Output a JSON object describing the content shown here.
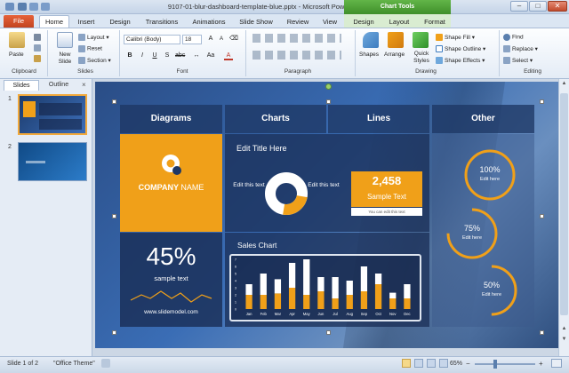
{
  "window": {
    "title": "9107-01-blur-dashboard-template-blue.pptx - Microsoft PowerPoint",
    "contextual_tab_group": "Chart Tools"
  },
  "tabs": [
    "File",
    "Home",
    "Insert",
    "Design",
    "Transitions",
    "Animations",
    "Slide Show",
    "Review",
    "View",
    "Design",
    "Layout",
    "Format"
  ],
  "ribbon": {
    "clipboard": {
      "paste": "Paste",
      "label": "Clipboard"
    },
    "slides": {
      "new_slide": "New Slide",
      "layout": "Layout",
      "reset": "Reset",
      "section": "Section",
      "label": "Slides"
    },
    "font": {
      "name": "Calibri (Body)",
      "size": "18",
      "label": "Font"
    },
    "paragraph": {
      "label": "Paragraph"
    },
    "drawing": {
      "shapes": "Shapes",
      "arrange": "Arrange",
      "quick_styles": "Quick Styles",
      "shape_fill": "Shape Fill",
      "shape_outline": "Shape Outline",
      "shape_effects": "Shape Effects",
      "label": "Drawing"
    },
    "editing": {
      "find": "Find",
      "replace": "Replace",
      "select": "Select",
      "label": "Editing"
    }
  },
  "left_pane": {
    "tab_slides": "Slides",
    "tab_outline": "Outline",
    "close": "×",
    "slide_numbers": [
      "1",
      "2"
    ]
  },
  "slide": {
    "headers": [
      "Diagrams",
      "Charts",
      "Lines",
      "Other"
    ],
    "company_name_1": "COMPANY",
    "company_name_2": "NAME",
    "big_percent": "45%",
    "sample_text": "sample text",
    "website": "www.slidemodel.com",
    "edit_title": "Edit Title Here",
    "edit_left": "Edit this text",
    "edit_right": "Edit this text",
    "big_number": "2,458",
    "sample_box_text": "Sample Text",
    "sample_box_sub": "You can edit this text",
    "sales_title": "Sales Chart",
    "donuts": [
      {
        "value": 100,
        "label": "100%",
        "sub": "Edit here"
      },
      {
        "value": 75,
        "label": "75%",
        "sub": "Edit here"
      },
      {
        "value": 50,
        "label": "50%",
        "sub": "Edit here"
      }
    ],
    "colors": {
      "accent": "#f0a019",
      "white": "#ffffff",
      "navy": "#1e3764"
    }
  },
  "chart_data": {
    "type": "bar",
    "categories": [
      "Jan",
      "Feb",
      "Mar",
      "Apr",
      "May",
      "Jun",
      "Jul",
      "Aug",
      "Sep",
      "Oct",
      "Nov",
      "Dec"
    ],
    "yticks": [
      "7",
      "6",
      "5",
      "4",
      "3",
      "2",
      "1",
      "0"
    ],
    "ylim": [
      0,
      7
    ],
    "series": [
      {
        "values": [
          2.0,
          2.0,
          2.2,
          3.0,
          2.0,
          2.5,
          1.5,
          2.0,
          2.5,
          3.5,
          1.5,
          1.5
        ]
      },
      {
        "values": [
          1.5,
          3.0,
          2.0,
          3.5,
          5.0,
          2.0,
          3.0,
          2.0,
          3.5,
          1.5,
          0.8,
          2.0
        ]
      }
    ]
  },
  "status": {
    "slide_info": "Slide 1 of 2",
    "theme": "\"Office Theme\"",
    "zoom": "65%"
  }
}
